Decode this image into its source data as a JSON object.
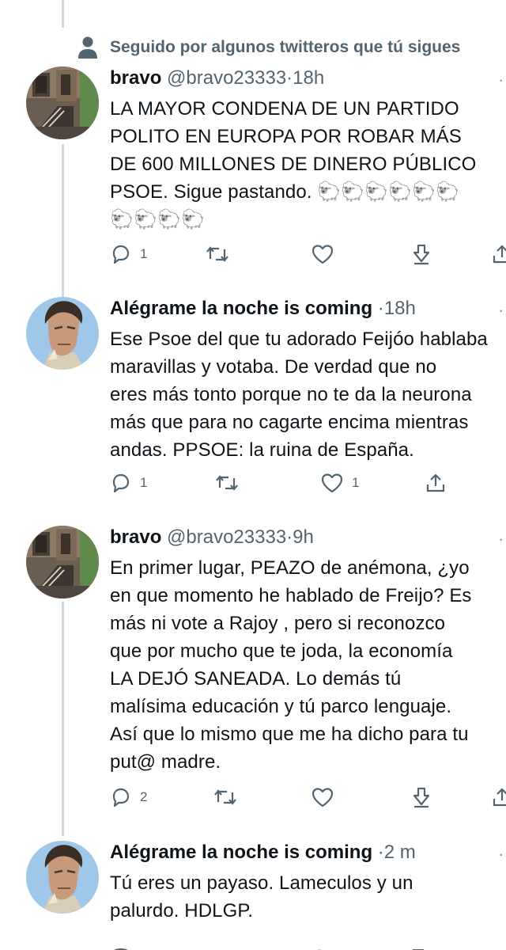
{
  "social_context": {
    "text": "Seguido por algunos twitteros que tú sigues"
  },
  "tweets": [
    {
      "name": "bravo",
      "handle": "@bravo23333",
      "separator": "·",
      "time": "18h",
      "lines": [
        "LA MAYOR CONDENA DE UN PARTIDO",
        "POLITO EN EUROPA POR ROBAR MÁS",
        "DE 600 MILLONES DE DINERO PÚBLICO",
        "PSOE. Sigue pastando. 🐑🐑🐑🐑🐑🐑",
        "🐑🐑🐑🐑"
      ],
      "replies": "1",
      "retweets": "",
      "likes": ""
    },
    {
      "name": "Alégrame la noche is coming",
      "handle": "",
      "separator": "·",
      "time": "18h",
      "lines": [
        "Ese Psoe del que tu adorado Feijóo hablaba",
        "maravillas y votaba. De verdad que no",
        "eres más tonto porque no te da la neurona",
        "más que para no cagarte encima mientras",
        "andas. PPSOE: la ruina de España."
      ],
      "replies": "1",
      "retweets": "",
      "likes": "1"
    },
    {
      "name": "bravo",
      "handle": "@bravo23333",
      "separator": "·",
      "time": "9h",
      "lines": [
        "En primer lugar, PEAZO de anémona, ¿yo",
        "en que momento he hablado de Freijo? Es",
        "más ni vote a Rajoy , pero si reconozco",
        "que por mucho que te joda, la economía",
        "LA DEJÓ SANEADA. Lo demás tú",
        "malísima educación y tú parco lenguaje.",
        "Así que lo mismo que me ha dicho para tu",
        "put@ madre."
      ],
      "replies": "2",
      "retweets": "",
      "likes": ""
    },
    {
      "name": "Alégrame la noche is coming",
      "handle": "",
      "separator": "·",
      "time": "2 m",
      "lines": [
        "Tú eres un payaso. Lameculos y un",
        "palurdo. HDLGP."
      ]
    }
  ],
  "icons": {
    "reply": "reply-icon",
    "retweet": "retweet-icon",
    "like": "heart-icon",
    "download": "download-icon",
    "share": "share-icon",
    "more": "more-icon",
    "person": "person-icon"
  },
  "colors": {
    "text": "#0f1419",
    "secondary": "#536471",
    "thread_line": "#cfd9de",
    "icon": "#536471"
  }
}
